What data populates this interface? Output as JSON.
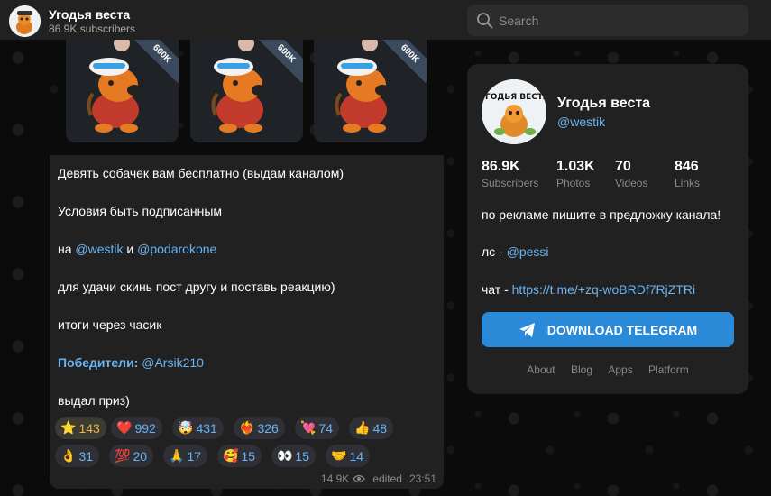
{
  "header": {
    "channel_title": "Угодья веста",
    "subscribers": "86.9K subscribers"
  },
  "search": {
    "placeholder": "Search"
  },
  "post": {
    "media": [
      {
        "badge": "600K"
      },
      {
        "badge": "600K"
      },
      {
        "badge": "600K"
      }
    ],
    "line1": "Девять собачек вам бесплатно (выдам каналом)",
    "line2": "Условия быть подписанным",
    "line3_prefix": "на ",
    "line3_link1": "@westik",
    "line3_mid": " и ",
    "line3_link2": "@podarokone",
    "line4": "для удачи скинь пост другу и поставь реакцию)",
    "line5": "итоги через часик",
    "line6_label": "Победители:",
    "line6_link": "@Arsik210",
    "line7": "выдал приз)",
    "reactions": [
      {
        "emoji": "⭐",
        "count": "143"
      },
      {
        "emoji": "❤️",
        "count": "992"
      },
      {
        "emoji": "🤯",
        "count": "431"
      },
      {
        "emoji": "❤️‍🔥",
        "count": "326"
      },
      {
        "emoji": "💘",
        "count": "74"
      },
      {
        "emoji": "👍",
        "count": "48"
      },
      {
        "emoji": "👌",
        "count": "31"
      },
      {
        "emoji": "💯",
        "count": "20"
      },
      {
        "emoji": "🙏",
        "count": "17"
      },
      {
        "emoji": "🥰",
        "count": "15"
      },
      {
        "emoji": "👀",
        "count": "15"
      },
      {
        "emoji": "🤝",
        "count": "14"
      }
    ],
    "views": "14.9K",
    "edited": "edited",
    "time": "23:51"
  },
  "card": {
    "name": "Угодья веста",
    "handle": "@westik",
    "avatar_text": "УГОДЬЯ ВЕСТА",
    "stats": [
      {
        "value": "86.9K",
        "label": "Subscribers"
      },
      {
        "value": "1.03K",
        "label": "Photos"
      },
      {
        "value": "70",
        "label": "Videos"
      },
      {
        "value": "846",
        "label": "Links"
      }
    ],
    "desc1": "по рекламе пишите в предложку канала!",
    "desc2_prefix": "лс - ",
    "desc2_link": "@pessi",
    "desc3_prefix": "чат - ",
    "desc3_link": "https://t.me/+zq-woBRDf7RjZTRi",
    "download_label": "DOWNLOAD TELEGRAM",
    "links": [
      "About",
      "Blog",
      "Apps",
      "Platform"
    ]
  },
  "colors": {
    "accent": "#6ab3f3",
    "button": "#2b8ad8",
    "panel": "#212121"
  }
}
